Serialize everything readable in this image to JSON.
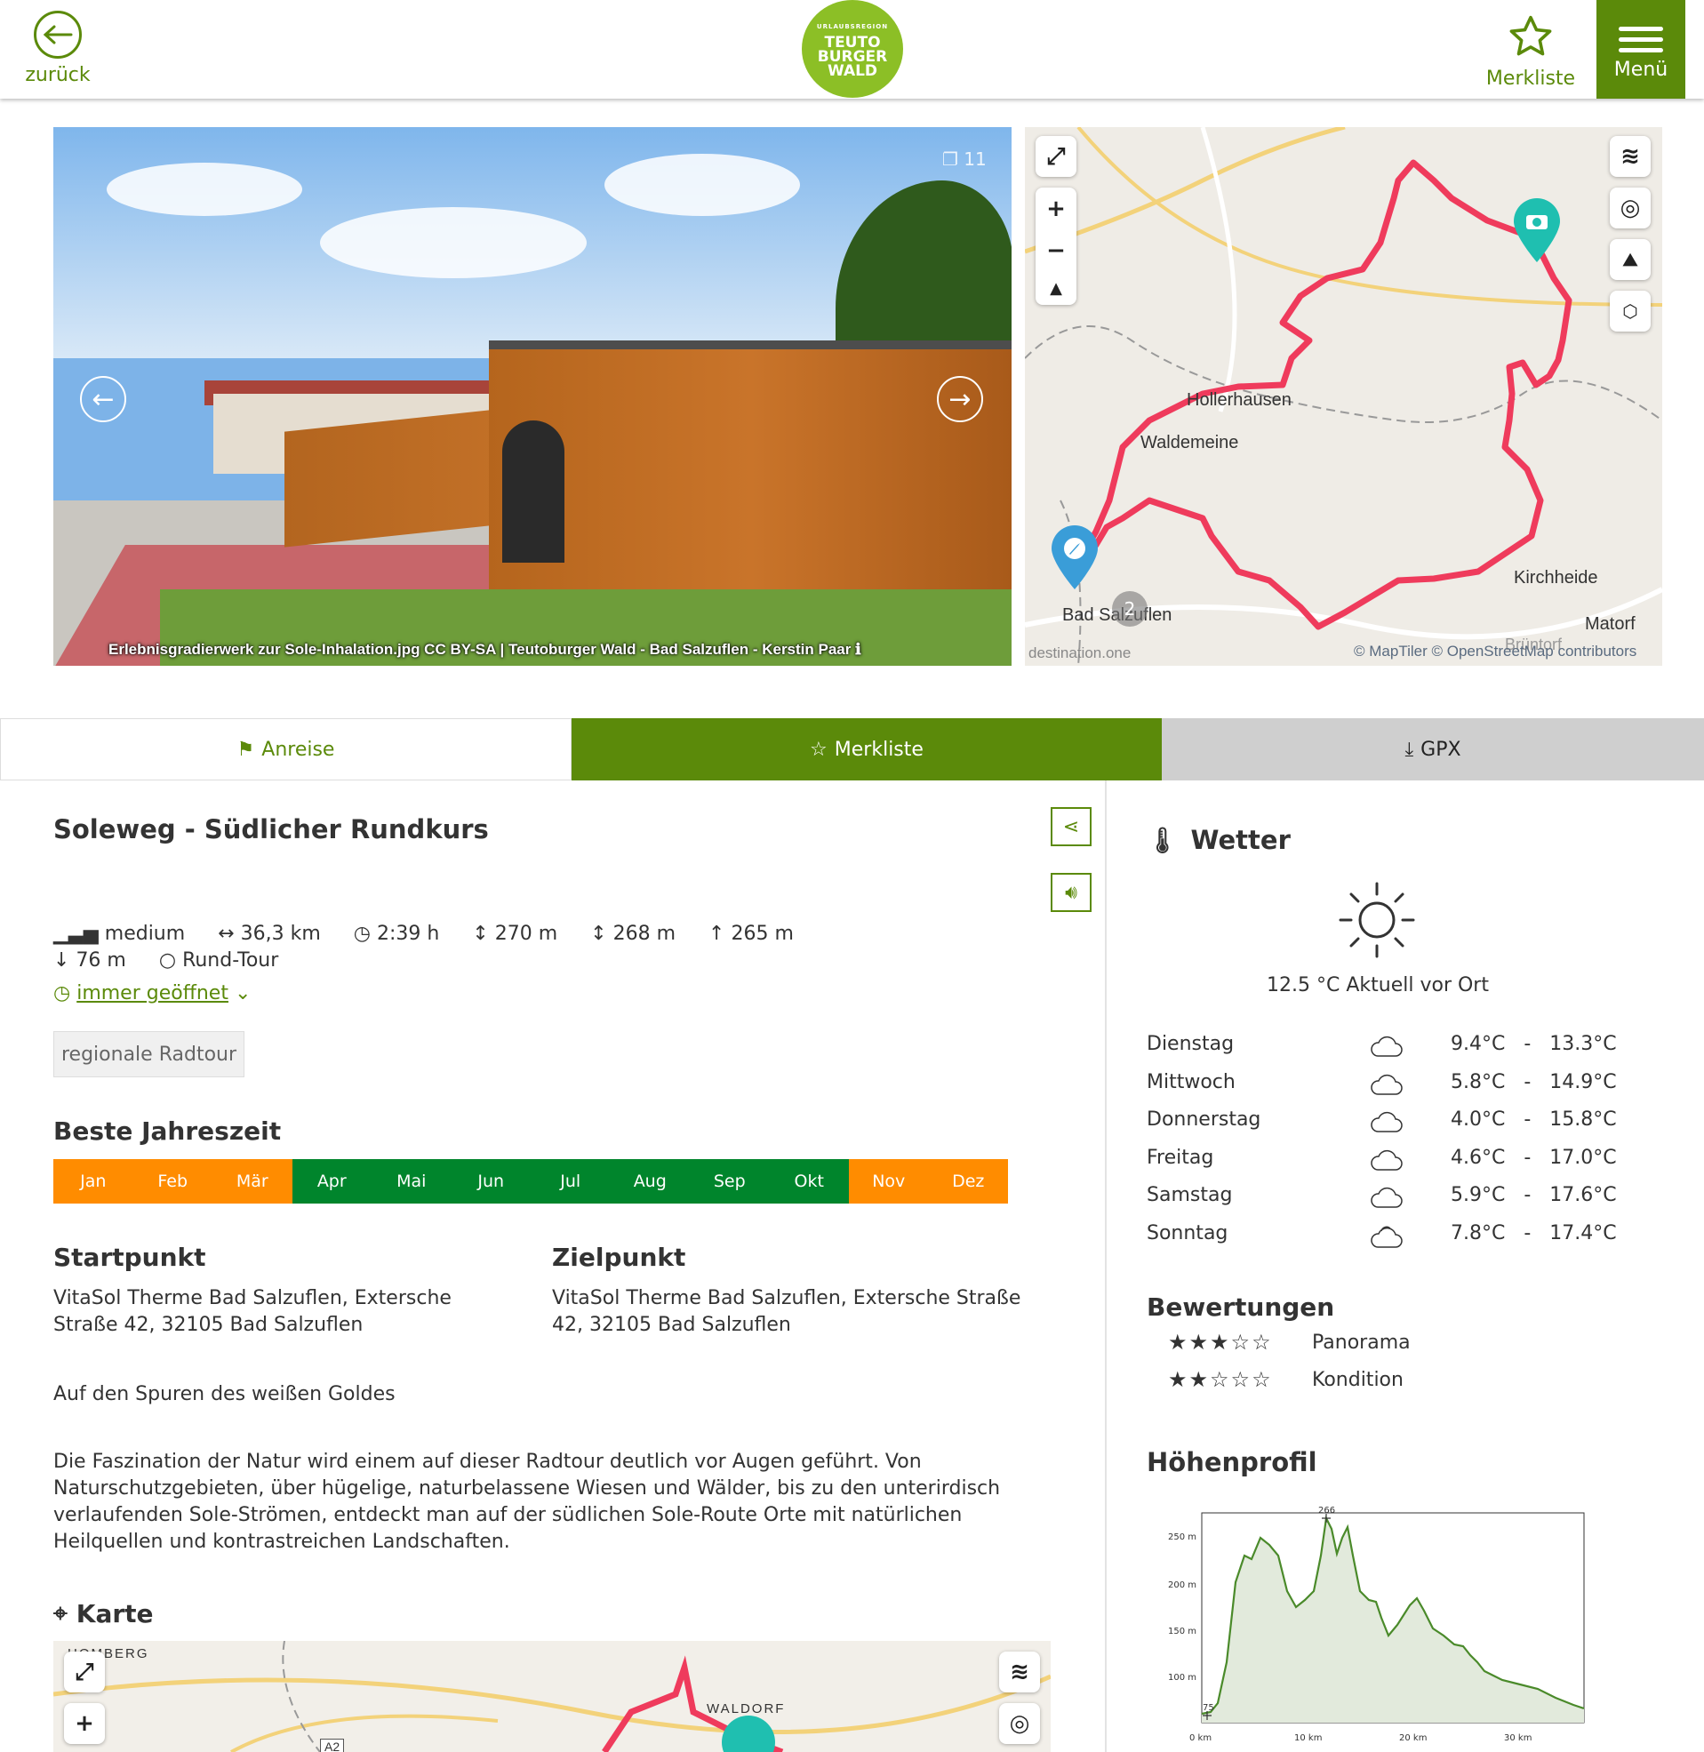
{
  "header": {
    "back_label": "zurück",
    "logo": {
      "small": "URLAUBSREGION",
      "line1": "TEUTO",
      "line2": "BURGER",
      "line3": "WALD"
    },
    "merkliste_label": "Merkliste",
    "menu_label": "Menü"
  },
  "gallery": {
    "counter": "11",
    "caption": "Erlebnisgradierwerk zur Sole-Inhalation.jpg CC BY-SA | Teutoburger Wald - Bad Salzuflen - Kerstin Paar"
  },
  "map_top": {
    "labels": [
      "Hollerhausen",
      "Waldemeine",
      "Kirchheide",
      "Bad Salzuflen",
      "Matorf",
      "Brüntorf"
    ],
    "cluster_count": "2",
    "watermark": "destination.one",
    "attribution": "© MapTiler © OpenStreetMap contributors"
  },
  "actions": {
    "anreise": "Anreise",
    "merkliste": "Merkliste",
    "gpx": "GPX"
  },
  "tour": {
    "title": "Soleweg - Südlicher Rundkurs",
    "stats": {
      "difficulty": "medium",
      "distance": "36,3 km",
      "duration": "2:39 h",
      "elevation_1": "270 m",
      "elevation_2": "268 m",
      "ascent": "265 m",
      "descent": "76 m",
      "type": "Rund-Tour"
    },
    "opening": "immer geöffnet",
    "tag": "regionale Radtour",
    "best_season_title": "Beste Jahreszeit",
    "months": [
      {
        "name": "Jan",
        "good": false
      },
      {
        "name": "Feb",
        "good": false
      },
      {
        "name": "Mär",
        "good": false
      },
      {
        "name": "Apr",
        "good": true
      },
      {
        "name": "Mai",
        "good": true
      },
      {
        "name": "Jun",
        "good": true
      },
      {
        "name": "Jul",
        "good": true
      },
      {
        "name": "Aug",
        "good": true
      },
      {
        "name": "Sep",
        "good": true
      },
      {
        "name": "Okt",
        "good": true
      },
      {
        "name": "Nov",
        "good": false
      },
      {
        "name": "Dez",
        "good": false
      }
    ],
    "start_title": "Startpunkt",
    "start_line1": "VitaSol Therme Bad Salzuflen, Extersche",
    "start_line2": "Straße 42, 32105 Bad Salzuflen",
    "end_title": "Zielpunkt",
    "end_line1": "VitaSol Therme Bad Salzuflen, Extersche Straße",
    "end_line2": "42, 32105 Bad Salzuflen",
    "lead": "Auf den Spuren des weißen Goldes",
    "description": "Die Faszination der Natur wird einem auf dieser Radtour deutlich vor Augen geführt. Von Naturschutzgebieten, über hügelige, naturbelassene Wiesen und Wälder, bis zu den unterirdisch verlaufenden Sole-Strömen, entdeckt man auf der südlichen Sole-Route Orte mit natürlichen Heilquellen und kontrastreichen Landschaften.",
    "map_title": "Karte",
    "map_labels": [
      "HOMBERG",
      "A2",
      "WALDORF"
    ]
  },
  "weather": {
    "title": "Wetter",
    "current": "12.5 °C Aktuell vor Ort",
    "forecast": [
      {
        "day": "Dienstag",
        "min": "9.4°C",
        "max": "13.3°C",
        "icon": "cloud-icon"
      },
      {
        "day": "Mittwoch",
        "min": "5.8°C",
        "max": "14.9°C",
        "icon": "cloud-icon"
      },
      {
        "day": "Donnerstag",
        "min": "4.0°C",
        "max": "15.8°C",
        "icon": "cloud-icon"
      },
      {
        "day": "Freitag",
        "min": "4.6°C",
        "max": "17.0°C",
        "icon": "cloud-icon"
      },
      {
        "day": "Samstag",
        "min": "5.9°C",
        "max": "17.6°C",
        "icon": "cloud-icon"
      },
      {
        "day": "Sonntag",
        "min": "7.8°C",
        "max": "17.4°C",
        "icon": "partly-cloudy-icon"
      }
    ],
    "separator": "-"
  },
  "ratings": {
    "title": "Bewertungen",
    "items": [
      {
        "label": "Panorama",
        "stars": 3,
        "max": 5
      },
      {
        "label": "Kondition",
        "stars": 2,
        "max": 5
      }
    ]
  },
  "elevation": {
    "title": "Höhenprofil",
    "peak_label": "266",
    "min_label": "75",
    "y_ticks": [
      "250 m",
      "200 m",
      "150 m",
      "100 m"
    ],
    "x_ticks": [
      "0 km",
      "10 km",
      "20 km",
      "30 km"
    ]
  },
  "colors": {
    "brand_green": "#5b8a0a",
    "month_good": "#00852c",
    "month_bad": "#ff8c00",
    "route": "#ef3b5c",
    "poi": "#1fbfb0"
  }
}
